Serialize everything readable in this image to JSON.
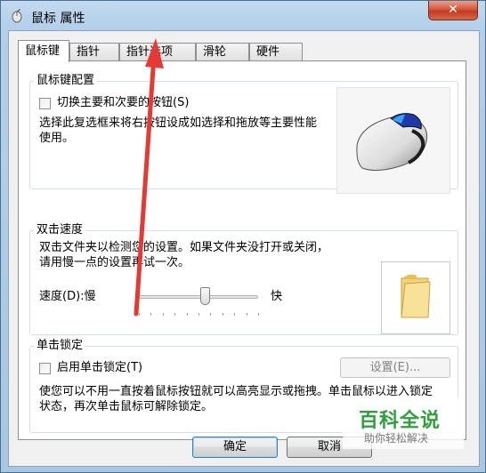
{
  "window": {
    "title": "鼠标 属性",
    "close_symbol": "✕"
  },
  "tabs": [
    {
      "label": "鼠标键",
      "active": true
    },
    {
      "label": "指针",
      "active": false
    },
    {
      "label": "指针选项",
      "active": false
    },
    {
      "label": "滑轮",
      "active": false
    },
    {
      "label": "硬件",
      "active": false
    }
  ],
  "button_config": {
    "title": "鼠标键配置",
    "switch_checkbox_label": "切换主要和次要的按钮(S)",
    "switch_checked": false,
    "description": "选择此复选框来将右按钮设成如选择和拖放等主要性能使用。",
    "image_icon": "mouse-icon"
  },
  "double_click": {
    "title": "双击速度",
    "description": "双击文件夹以检测您的设置。如果文件夹没打开或关闭，请用慢一点的设置再试一次。",
    "speed_label": "速度(D):慢",
    "fast_label": "快",
    "speed_level": 0.55,
    "test_icon": "folder-icon"
  },
  "click_lock": {
    "title": "单击锁定",
    "checkbox_label": "启用单击锁定(T)",
    "checked": false,
    "settings_button": "设置(E)...",
    "description": "使您可以不用一直按着鼠标按钮就可以高亮显示或拖拽。单击鼠标以进入锁定状态，再次单击鼠标可解除锁定。"
  },
  "footer": {
    "ok_label": "确定",
    "cancel_label": "取消"
  },
  "watermark": {
    "title": "百科全说",
    "subtitle": "助你轻松解决"
  },
  "colors": {
    "arrow": "#e53935",
    "watermark_green": "#2f9e3d",
    "title_bar": "#b9d3ec"
  }
}
